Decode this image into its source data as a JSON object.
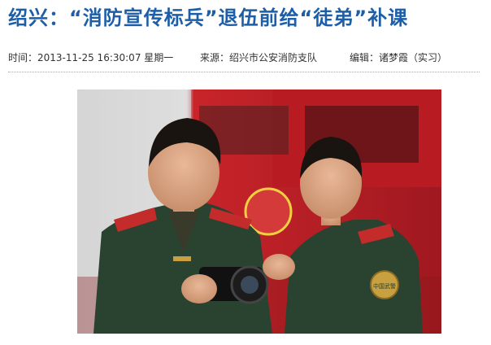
{
  "article": {
    "headline": "绍兴：“消防宣传标兵”退伍前给“徒弟”补课",
    "meta": {
      "time": "时间：2013-11-25 16:30:07 星期一",
      "source": "来源：绍兴市公安消防支队",
      "editor": "编辑：诸梦霞（实习）"
    }
  },
  "photo": {
    "alt_subject": "two-soldiers-with-camera",
    "colors": {
      "truck_red": "#c8242a",
      "uniform": "#2a4330",
      "epaulette_red": "#c42b2b",
      "headline_blue": "#1d5ea8"
    },
    "badge_text": "中国武警"
  }
}
